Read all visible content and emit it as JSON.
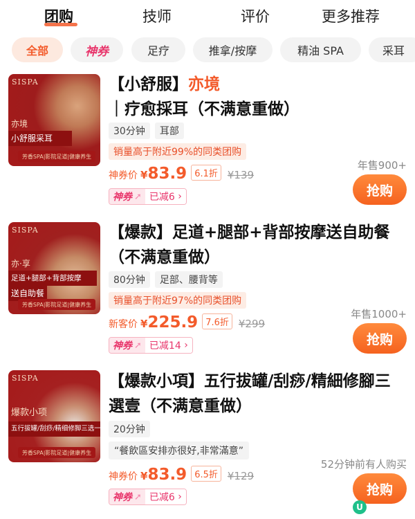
{
  "tabs": [
    {
      "label": "团购",
      "active": true
    },
    {
      "label": "技师",
      "active": false
    },
    {
      "label": "评价",
      "active": false
    },
    {
      "label": "更多推荐",
      "active": false
    }
  ],
  "filters": [
    "全部",
    "神券",
    "足疗",
    "推拿/按摩",
    "精油 SPA",
    "采耳"
  ],
  "selected_filter": "全部",
  "colors": {
    "accent": "#f35b2b",
    "coupon": "#e8356b",
    "buy_button": "#f5621f"
  },
  "deals": [
    {
      "thumb": {
        "brand": "SISPA",
        "line1": "亦境",
        "line2": "小舒服采耳",
        "footer": "芳香SPA|影院足道|健康养生"
      },
      "title_prefix": "【小舒服】",
      "title_highlight": "亦境",
      "title_rest": "｜疗愈採耳（不满意重做）",
      "tags": [
        "30分钟",
        "耳部"
      ],
      "rank": "销量高于附近99%的同类团购",
      "price_prefix": "神券价",
      "currency": "¥",
      "price": "83.9",
      "discount": "6.1折",
      "original": "¥139",
      "coupon_label": "神券",
      "coupon_saving": "已减6",
      "sold": "年售900+",
      "buy_label": "抢购"
    },
    {
      "thumb": {
        "brand": "SISPA",
        "line1": "亦·享",
        "line2": "足道+腿部+背部按摩",
        "line3": "送自助餐",
        "footer": "芳香SPA|影院足道|健康养生"
      },
      "title_prefix": "【爆款】足道+腿部+背部按摩送自助餐（不满意重做）",
      "tags": [
        "80分钟",
        "足部、腰背等"
      ],
      "rank": "销量高于附近97%的同类团购",
      "price_prefix": "新客价",
      "currency": "¥",
      "price": "225.9",
      "discount": "7.6折",
      "original": "¥299",
      "coupon_label": "神券",
      "coupon_saving": "已减14",
      "sold": "年售1000+",
      "buy_label": "抢购"
    },
    {
      "thumb": {
        "brand": "SISPA",
        "line1": "爆款小项",
        "line2": "五行拔罐/刮痧/精细修脚三选一",
        "footer": "芳香SPA|影院足道|健康养生"
      },
      "title_prefix": "【爆款小項】五行拔罐/刮痧/精細修腳三選壹（不满意重做）",
      "tags": [
        "20分钟"
      ],
      "review": "“餐飲區安排亦很好,非常滿意”",
      "price_prefix": "神券价",
      "currency": "¥",
      "price": "83.9",
      "discount": "6.5折",
      "original": "¥129",
      "coupon_label": "神券",
      "coupon_saving": "已减6",
      "sold": "52分钟前有人购买",
      "buy_label": "抢购"
    }
  ]
}
